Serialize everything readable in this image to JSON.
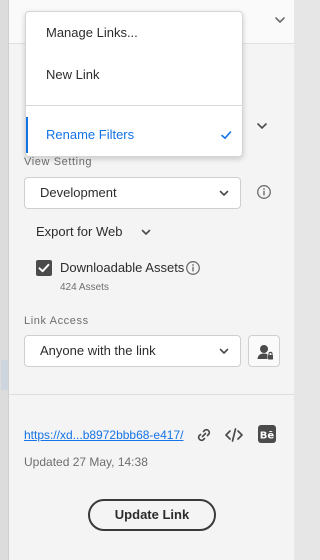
{
  "menu": {
    "items": [
      {
        "label": "Manage Links..."
      },
      {
        "label": "New Link"
      },
      {
        "label": "Rename Filters"
      }
    ]
  },
  "view_setting": {
    "label": "View Setting",
    "selected": "Development"
  },
  "export": {
    "label": "Export for Web"
  },
  "downloadable": {
    "label": "Downloadable Assets",
    "count_text": "424 Assets",
    "checked": true
  },
  "link_access": {
    "label": "Link Access",
    "selected": "Anyone with the link"
  },
  "share": {
    "url_text": "https://xd...b8972bbb68-e417/",
    "updated_text": "Updated 27 May, 14:38",
    "update_button": "Update Link"
  },
  "icons": {
    "chevron": "chevron-down-icon",
    "check": "checkmark-icon",
    "info": "info-icon",
    "user_lock": "user-lock-icon",
    "copy_link": "link-icon",
    "embed": "code-icon",
    "behance": "behance-icon"
  },
  "colors": {
    "accent": "#1473e6",
    "text": "#2c2c2c",
    "muted": "#6e6e6e"
  }
}
